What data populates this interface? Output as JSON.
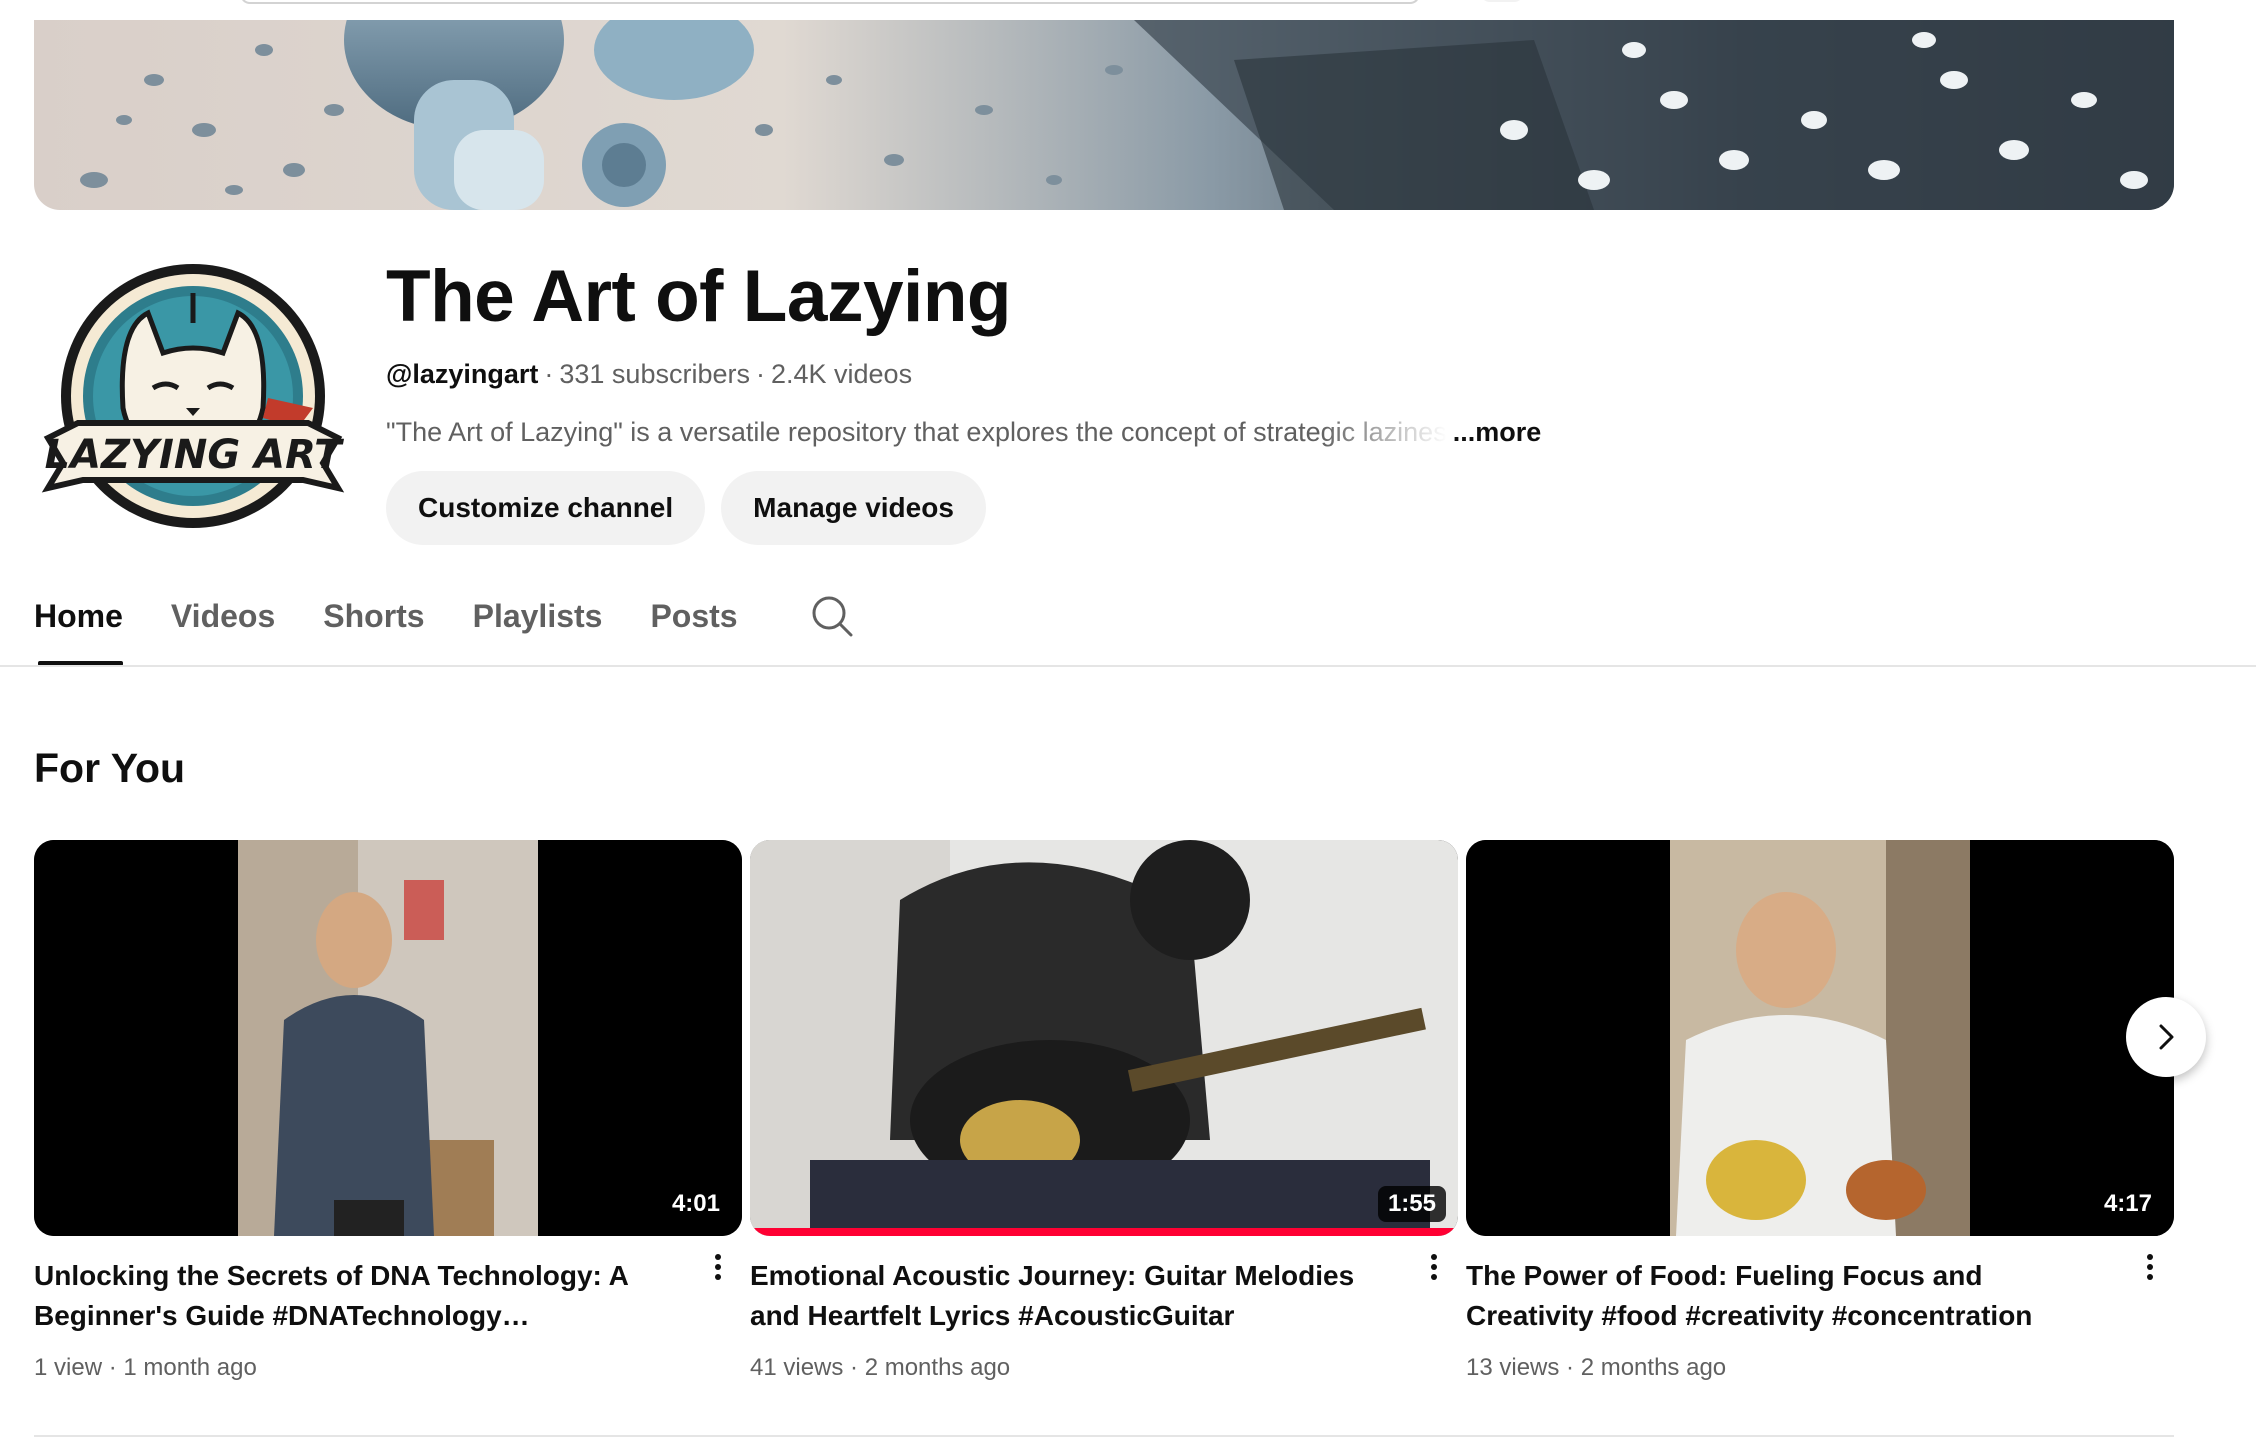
{
  "channel": {
    "title": "The Art of Lazying",
    "handle": "@lazyingart",
    "subscribers": "331 subscribers",
    "videos_count": "2.4K videos",
    "description": "\"The Art of Lazying\" is a versatile repository that explores the concept of strategic lazines",
    "more_label": "...more",
    "avatar_text": "LAZYING ART"
  },
  "actions": {
    "customize_label": "Customize channel",
    "manage_label": "Manage videos"
  },
  "tabs": [
    {
      "label": "Home",
      "active": true
    },
    {
      "label": "Videos",
      "active": false
    },
    {
      "label": "Shorts",
      "active": false
    },
    {
      "label": "Playlists",
      "active": false
    },
    {
      "label": "Posts",
      "active": false
    }
  ],
  "section": {
    "title": "For You"
  },
  "videos": [
    {
      "title": "Unlocking the Secrets of DNA Technology: A Beginner's Guide #DNATechnology…",
      "duration": "4:01",
      "views": "1 view",
      "age": "1 month ago"
    },
    {
      "title": "Emotional Acoustic Journey: Guitar Melodies and Heartfelt Lyrics #AcousticGuitar #MusicJourney",
      "duration": "1:55",
      "views": "41 views",
      "age": "2 months ago",
      "watched_fraction": 1.0
    },
    {
      "title": "The Power of Food: Fueling Focus and Creativity #food #creativity #concentration #cognitivefunction",
      "duration": "4:17",
      "views": "13 views",
      "age": "2 months ago"
    }
  ],
  "colors": {
    "text_primary": "#0f0f0f",
    "text_secondary": "#606060",
    "pill_bg": "#f2f2f2",
    "progress_red": "#ff0033"
  },
  "icons": {
    "tab_search": "search-icon",
    "carousel_next": "chevron-right-icon",
    "card_menu": "more-vert-icon"
  }
}
